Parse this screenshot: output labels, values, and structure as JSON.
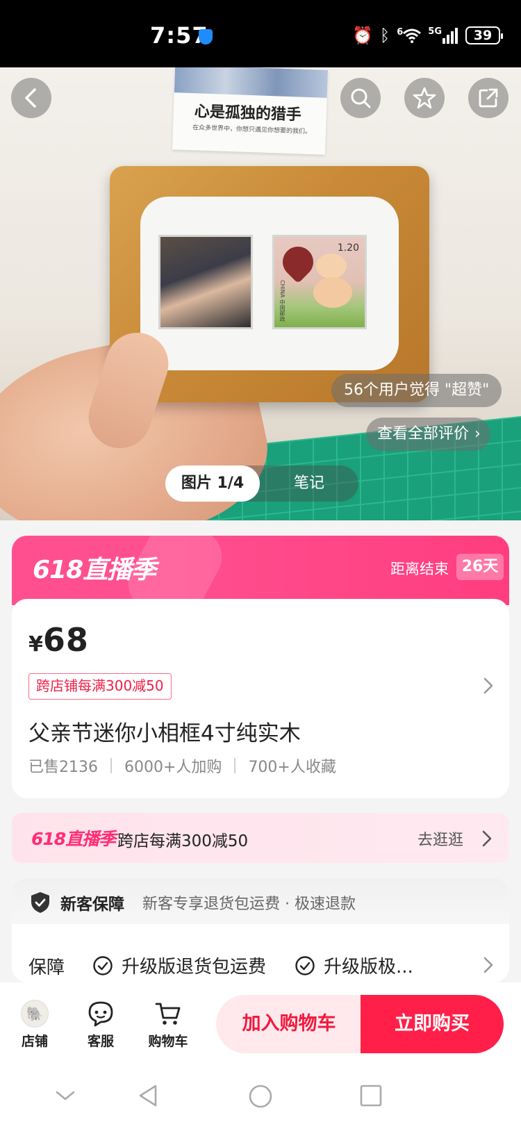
{
  "status_bar": {
    "time": "7:57",
    "network": "5G",
    "wifi": "6",
    "battery": "39"
  },
  "hero": {
    "poster_title": "心是孤独的猎手",
    "poster_subtitle": "在众多世界中，你想只遇见你想要的我们。",
    "stamp_value": "1.20",
    "stamp_country": "CHINA 中国邮政",
    "review_text": "56个用户觉得 \"超赞\"",
    "all_reviews": "查看全部评价",
    "tab_picture": "图片 1/4",
    "tab_notes": "笔记"
  },
  "promo": {
    "logo": "618直播季",
    "ends_label": "距离结束",
    "days": "26天"
  },
  "product": {
    "price_symbol": "¥",
    "price": "68",
    "coupon": "跨店铺每满300减50",
    "title": "父亲节迷你小相框4寸纯实木",
    "sold": "已售2136",
    "added": "6000+人加购",
    "favorited": "700+人收藏"
  },
  "promo_strip": {
    "logo": "618直播季",
    "text": "跨店每满300减50",
    "cta": "去逛逛"
  },
  "guarantee": {
    "title": "新客保障",
    "desc": "新客专享退货包运费 · 极速退款",
    "label": "保障",
    "item1": "升级版退货包运费",
    "item2": "升级版极..."
  },
  "action_bar": {
    "store": "店铺",
    "service": "客服",
    "cart": "购物车",
    "add_to_cart": "加入购物车",
    "buy_now": "立即购买"
  },
  "colors": {
    "accent": "#ff1f48",
    "promo_pink": "#ff4f8f",
    "coupon_red": "#f02048"
  }
}
